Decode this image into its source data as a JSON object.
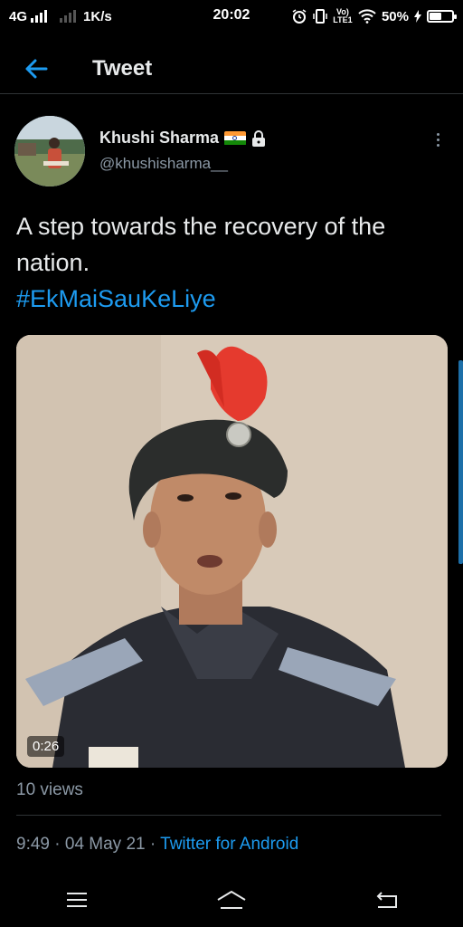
{
  "status_bar": {
    "network": "4G",
    "speed": "1K/s",
    "time": "20:02",
    "lte": "Vo) LTE1",
    "battery": "50%",
    "battery_level": 0.5
  },
  "header": {
    "title": "Tweet"
  },
  "author": {
    "name": "Khushi Sharma",
    "flag": "🇮🇳",
    "handle": "@khushisharma__"
  },
  "tweet": {
    "text_line1": "A step towards the recovery of the",
    "text_line2": "nation.",
    "hashtag": "#EkMaiSauKeLiye"
  },
  "video": {
    "duration": "0:26"
  },
  "stats": {
    "views": "10 views"
  },
  "meta": {
    "time": "9:49",
    "date": "04 May 21",
    "separator": " · ",
    "source": "Twitter for Android"
  },
  "icons": {
    "back": "arrow-left-icon",
    "lock": "lock-icon",
    "more": "more-vertical-icon",
    "menu": "menu-icon",
    "home": "home-icon",
    "return": "back-icon"
  },
  "colors": {
    "accent": "#1d9bf0",
    "text": "#e7e9ea",
    "secondary": "#8b98a5",
    "background": "#000000"
  }
}
